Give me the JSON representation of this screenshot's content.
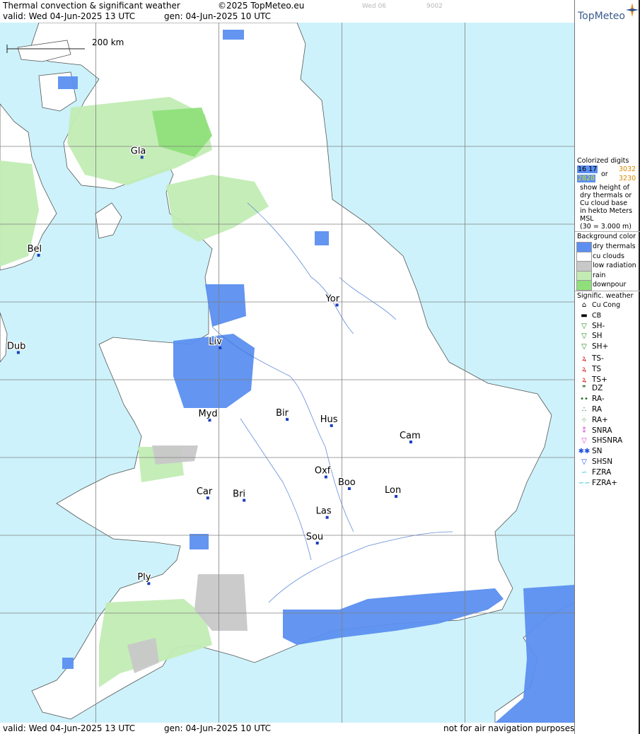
{
  "header": {
    "title": "Thermal convection & significant weather",
    "copyright": "©2025 TopMeteo.eu",
    "faint_day": "Wed 06",
    "faint_code": "9002",
    "valid": "valid:  Wed  04-Jun-2025  13 UTC",
    "generated": "gen: 04-Jun-2025 10 UTC",
    "brand": "TopMeteo"
  },
  "footer": {
    "valid": "valid:  Wed  04-Jun-2025  13 UTC",
    "generated": "gen: 04-Jun-2025 10 UTC",
    "disclaimer": "not for air navigation purposes"
  },
  "map": {
    "scale_label": "200 km",
    "colors": {
      "sea": "#cdf2fb",
      "land": "#ffffff",
      "dry": "#5b8ff0",
      "rain": "#c2ecb4",
      "downpour": "#8fe07a",
      "low_radiation": "#c8c8c8",
      "grid": "#808080",
      "river": "#3d6fd0",
      "coast": "#555555"
    },
    "places": [
      {
        "name": "Gla",
        "x": -4.25,
        "y": 55.86
      },
      {
        "name": "Bel",
        "x": -5.93,
        "y": 54.6
      },
      {
        "name": "Yor",
        "x": -1.08,
        "y": 53.96
      },
      {
        "name": "Liv",
        "x": -2.98,
        "y": 53.41
      },
      {
        "name": "Myd",
        "x": -3.15,
        "y": 52.48
      },
      {
        "name": "Bir",
        "x": -1.89,
        "y": 52.49
      },
      {
        "name": "Hus",
        "x": -1.17,
        "y": 52.41
      },
      {
        "name": "Cam",
        "x": 0.12,
        "y": 52.2
      },
      {
        "name": "Oxf",
        "x": -1.26,
        "y": 51.75
      },
      {
        "name": "Boo",
        "x": -0.88,
        "y": 51.6
      },
      {
        "name": "Lon",
        "x": -0.12,
        "y": 51.5
      },
      {
        "name": "Car",
        "x": -3.18,
        "y": 51.48
      },
      {
        "name": "Bri",
        "x": -2.59,
        "y": 51.45
      },
      {
        "name": "Las",
        "x": -1.24,
        "y": 51.23
      },
      {
        "name": "Sou",
        "x": -1.4,
        "y": 50.9
      },
      {
        "name": "Ply",
        "x": -4.14,
        "y": 50.38
      },
      {
        "name": "Dub",
        "x": -6.26,
        "y": 53.35
      }
    ],
    "gridlines_lon": [
      -5,
      -3,
      -1,
      1,
      3
    ],
    "gridlines_lat": [
      50,
      51,
      52,
      53,
      54,
      55,
      56
    ]
  },
  "legend": {
    "digits_title": "Colorized digits",
    "digits_examples": [
      "16 17",
      "3032",
      "2828",
      "3230"
    ],
    "digits_or": "or",
    "digits_desc": [
      "show height of",
      "dry thermals or",
      "Cu cloud base",
      "in hekto Meters",
      "MSL",
      "(30 = 3.000 m)"
    ],
    "bg_title": "Background color",
    "bg_items": [
      {
        "label": "dry thermals",
        "color": "#5b8ff0"
      },
      {
        "label": "cu clouds",
        "color": "#ffffff"
      },
      {
        "label": "low radiation",
        "color": "#c8c8c8"
      },
      {
        "label": "rain",
        "color": "#c2ecb4"
      },
      {
        "label": "downpour",
        "color": "#8fe07a"
      }
    ],
    "sig_title": "Signific. weather",
    "sig_items": [
      {
        "label": "Cu Cong",
        "glyph": "⌂",
        "color": "#000000"
      },
      {
        "label": "CB",
        "glyph": "▬",
        "color": "#000000"
      },
      {
        "label": "SH-",
        "glyph": "▽",
        "color": "#1d8a1d"
      },
      {
        "label": "SH",
        "glyph": "▽",
        "color": "#1d8a1d"
      },
      {
        "label": "SH+",
        "glyph": "▽",
        "color": "#1d8a1d"
      },
      {
        "label": "TS-",
        "glyph": "ꝝ",
        "color": "#d02020"
      },
      {
        "label": "TS",
        "glyph": "ꝝ",
        "color": "#d02020"
      },
      {
        "label": "TS+",
        "glyph": "ꝝ",
        "color": "#d02020"
      },
      {
        "label": "DZ",
        "glyph": "❞",
        "color": "#1d6a1d"
      },
      {
        "label": "RA-",
        "glyph": "••",
        "color": "#1d6a1d"
      },
      {
        "label": "RA",
        "glyph": "∴",
        "color": "#1d6a1d"
      },
      {
        "label": "RA+",
        "glyph": "⁘",
        "color": "#1d6a1d"
      },
      {
        "label": "SNRA",
        "glyph": "⁑",
        "color": "#d040d0"
      },
      {
        "label": "SHSNRA",
        "glyph": "▽",
        "color": "#d040d0"
      },
      {
        "label": "SN",
        "glyph": "✱✱",
        "color": "#2050e0"
      },
      {
        "label": "SHSN",
        "glyph": "▽",
        "color": "#2050e0"
      },
      {
        "label": "FZRA",
        "glyph": "∽",
        "color": "#20b8d8"
      },
      {
        "label": "FZRA+",
        "glyph": "∽∽",
        "color": "#20b8d8"
      }
    ]
  }
}
